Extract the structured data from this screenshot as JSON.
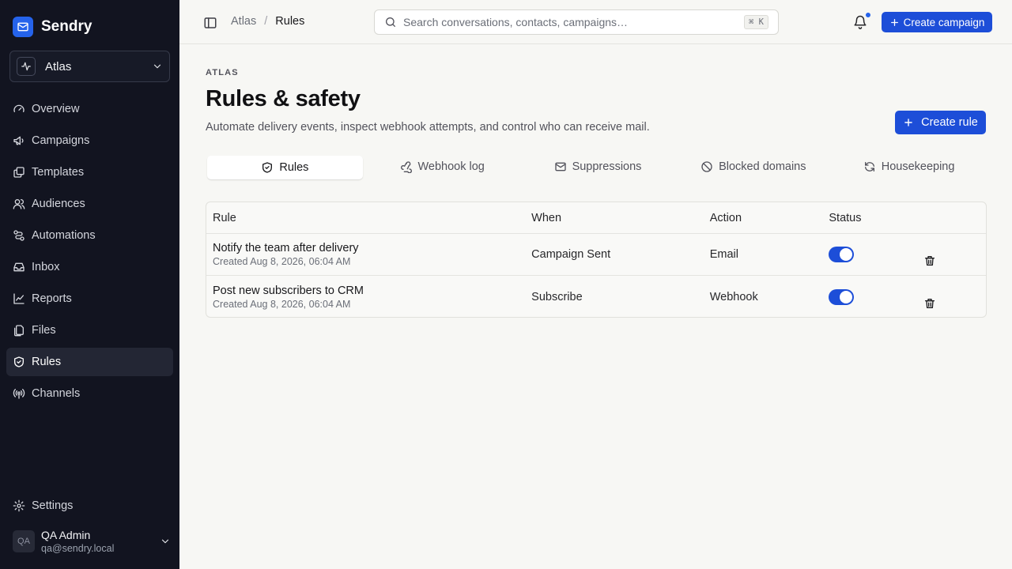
{
  "app": {
    "name": "Sendry"
  },
  "workspace": {
    "name": "Atlas"
  },
  "sidebar": {
    "items": [
      {
        "label": "Overview",
        "icon": "gauge-icon"
      },
      {
        "label": "Campaigns",
        "icon": "megaphone-icon"
      },
      {
        "label": "Templates",
        "icon": "layers-icon"
      },
      {
        "label": "Audiences",
        "icon": "users-icon"
      },
      {
        "label": "Automations",
        "icon": "workflow-icon"
      },
      {
        "label": "Inbox",
        "icon": "inbox-icon"
      },
      {
        "label": "Reports",
        "icon": "chart-icon"
      },
      {
        "label": "Files",
        "icon": "files-icon"
      },
      {
        "label": "Rules",
        "icon": "shield-icon",
        "active": true
      },
      {
        "label": "Channels",
        "icon": "radio-icon"
      }
    ],
    "settings_label": "Settings"
  },
  "user": {
    "initials": "QA",
    "name": "QA Admin",
    "email": "qa@sendry.local"
  },
  "topbar": {
    "breadcrumb_parent": "Atlas",
    "breadcrumb_sep": "/",
    "breadcrumb_current": "Rules",
    "search_placeholder": "Search conversations, contacts, campaigns…",
    "search_shortcut": "⌘ K",
    "create_campaign_label": "Create campaign",
    "notifications_unread": true
  },
  "page": {
    "eyebrow": "ATLAS",
    "title": "Rules & safety",
    "description": "Automate delivery events, inspect webhook attempts, and control who can receive mail.",
    "create_rule_label": "Create rule"
  },
  "tabs": [
    {
      "label": "Rules",
      "icon": "shield-check-icon",
      "active": true
    },
    {
      "label": "Webhook log",
      "icon": "webhook-icon"
    },
    {
      "label": "Suppressions",
      "icon": "mail-icon"
    },
    {
      "label": "Blocked domains",
      "icon": "ban-icon"
    },
    {
      "label": "Housekeeping",
      "icon": "refresh-icon"
    }
  ],
  "table": {
    "columns": [
      "Rule",
      "When",
      "Action",
      "Status"
    ],
    "rows": [
      {
        "name": "Notify the team after delivery",
        "created": "Created Aug 8, 2026, 06:04 AM",
        "when": "Campaign Sent",
        "action": "Email",
        "enabled": true
      },
      {
        "name": "Post new subscribers to CRM",
        "created": "Created Aug 8, 2026, 06:04 AM",
        "when": "Subscribe",
        "action": "Webhook",
        "enabled": true
      }
    ]
  },
  "colors": {
    "accent": "#1d4ed8",
    "sidebar_bg": "#121420",
    "page_bg": "#f7f7f4"
  }
}
